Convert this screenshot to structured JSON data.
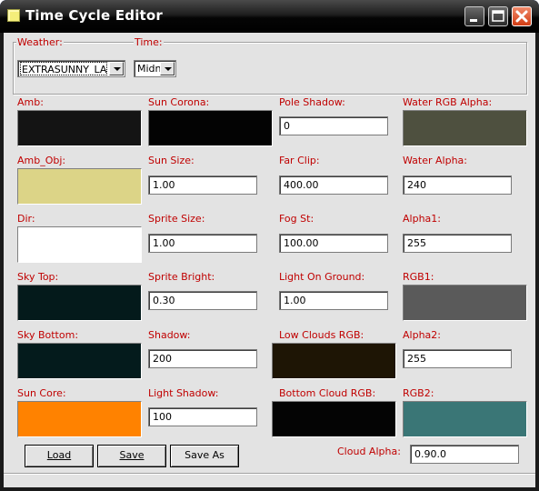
{
  "window": {
    "title": "Time Cycle Editor",
    "title_color": "#ffffff"
  },
  "selectors": {
    "weather_label": "Weather:",
    "weather_value": "EXTRASUNNY_LA",
    "time_label": "Time:",
    "time_value": "Midn"
  },
  "fields": {
    "amb": {
      "label": "Amb:",
      "color": "#141414"
    },
    "sun_corona": {
      "label": "Sun Corona:",
      "color": "#030303"
    },
    "pole_shadow": {
      "label": "Pole Shadow:",
      "value": "0"
    },
    "water_rgb_alpha": {
      "label": "Water RGB Alpha:",
      "color": "#4e503f"
    },
    "amb_obj": {
      "label": "Amb_Obj:",
      "color": "#dcd487"
    },
    "sun_size": {
      "label": "Sun Size:",
      "value": "1.00"
    },
    "far_clip": {
      "label": "Far Clip:",
      "value": "400.00"
    },
    "water_alpha": {
      "label": "Water Alpha:",
      "value": "240"
    },
    "dir": {
      "label": "Dir:",
      "color": "#ffffff"
    },
    "sprite_size": {
      "label": "Sprite Size:",
      "value": "1.00"
    },
    "fog_st": {
      "label": "Fog St:",
      "value": "100.00"
    },
    "alpha1": {
      "label": "Alpha1:",
      "value": "255"
    },
    "sky_top": {
      "label": "Sky Top:",
      "color": "#041a1b"
    },
    "sprite_bright": {
      "label": "Sprite Bright:",
      "value": "0.30"
    },
    "light_on_ground": {
      "label": "Light On Ground:",
      "value": "1.00"
    },
    "rgb1": {
      "label": "RGB1:",
      "color": "#5a5a5a"
    },
    "sky_bottom": {
      "label": "Sky Bottom:",
      "color": "#041b1c"
    },
    "shadow": {
      "label": "Shadow:",
      "value": "200"
    },
    "low_clouds_rgb": {
      "label": "Low Clouds RGB:",
      "color": "#1e1505"
    },
    "alpha2": {
      "label": "Alpha2:",
      "value": "255"
    },
    "sun_core": {
      "label": "Sun Core:",
      "color": "#ff8200"
    },
    "light_shadow": {
      "label": "Light Shadow:",
      "value": "100"
    },
    "bottom_cloud_rgb": {
      "label": "Bottom Cloud RGB:",
      "color": "#040404"
    },
    "rgb2": {
      "label": "RGB2:",
      "color": "#3a7676"
    },
    "cloud_alpha": {
      "label": "Cloud Alpha:",
      "value": "0.90.0"
    }
  },
  "buttons": {
    "load": "Load",
    "save": "Save",
    "save_as": "Save As"
  },
  "colors": {
    "label_red": "#c00000",
    "client_bg": "#e3e3e3"
  }
}
